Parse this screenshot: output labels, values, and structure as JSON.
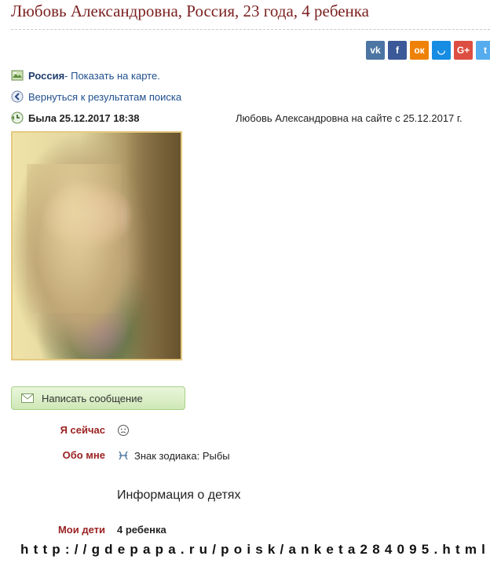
{
  "title": "Любовь Александровна, Россия, 23 года, 4 ребенка",
  "share": [
    {
      "name": "vk-share-button",
      "label": "vk",
      "color": "#4c75a3"
    },
    {
      "name": "facebook-share-button",
      "label": "f",
      "color": "#3b5998"
    },
    {
      "name": "odnoklassniki-share-button",
      "label": "ок",
      "color": "#ee8208"
    },
    {
      "name": "moimir-share-button",
      "label": "◡",
      "color": "#168de2"
    },
    {
      "name": "googleplus-share-button",
      "label": "G+",
      "color": "#dc4e41"
    },
    {
      "name": "twitter-share-button",
      "label": "t",
      "color": "#55acee"
    }
  ],
  "location": {
    "country": "Россия",
    "map_link": " - Показать на карте."
  },
  "back_link": "Вернуться к результатам поиска",
  "last_seen": "Была 25.12.2017 18:38",
  "member_since": "Любовь Александровна на сайте с 25.12.2017 г.",
  "message_button": "Написать сообщение",
  "fields": {
    "now_label": "Я сейчас",
    "about_label": "Обо мне",
    "about_value": "Знак зодиака: Рыбы",
    "kids_section": "Информация о детях",
    "kids_label": "Мои дети",
    "kids_value": "4 ребенка"
  },
  "watermark_url": "http://gdepapa.ru/poisk/anketa284095.html"
}
